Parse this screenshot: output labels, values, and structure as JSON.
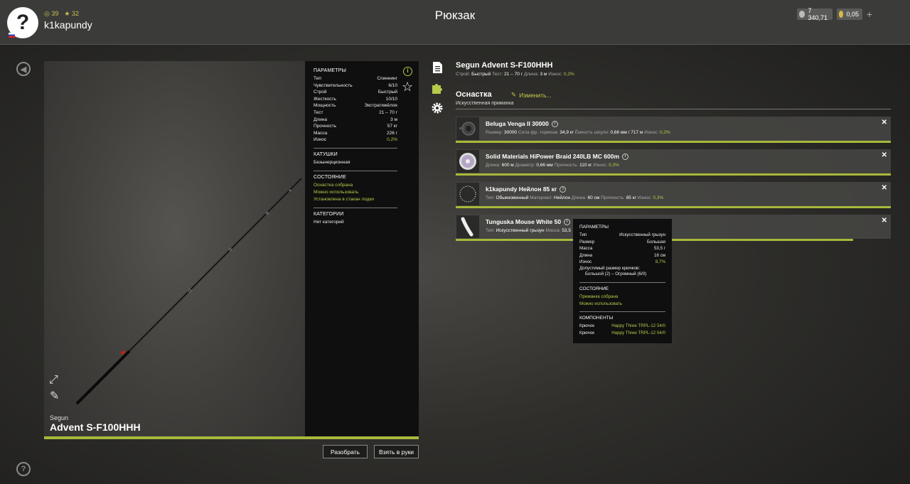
{
  "header": {
    "title": "Рюкзак",
    "username": "k1kapundy",
    "avatar_glyph": "?",
    "stat_level": "39",
    "stat_rank": "32",
    "silver": "7 340,71",
    "gold": "0,05",
    "plus": "+"
  },
  "rod": {
    "brand": "Segun",
    "name": "Advent S-F100HHH",
    "params_title": "ПАРАМЕТРЫ",
    "params": [
      {
        "k": "Тип",
        "v": "Спиннинг"
      },
      {
        "k": "Чувствительность",
        "v": "6/10"
      },
      {
        "k": "Строй",
        "v": "Быстрый"
      },
      {
        "k": "Жесткость",
        "v": "10/10"
      },
      {
        "k": "Мощность",
        "v": "Экстратяжёлое"
      },
      {
        "k": "Тест",
        "v": "21 – 70 г"
      },
      {
        "k": "Длина",
        "v": "3 м"
      },
      {
        "k": "Прочность",
        "v": "57 кг"
      },
      {
        "k": "Масса",
        "v": "226 г"
      },
      {
        "k": "Износ",
        "v": "0,2%"
      }
    ],
    "reels_title": "КАТУШКИ",
    "reels_value": "Безынерционная",
    "state_title": "СОСТОЯНИЕ",
    "state": [
      "Оснастка собрана",
      "Можно использовать",
      "Установлена в стакан лодки"
    ],
    "cat_title": "КАТЕГОРИИ",
    "cat_value": "Нет категорий"
  },
  "buttons": {
    "disassemble": "Разобрать",
    "take": "Взять в руки"
  },
  "detail": {
    "title": "Segun Advent S-F100HHH",
    "sub": {
      "build_k": "Строй:",
      "build_v": "Быстрый",
      "test_k": "Тест:",
      "test_v": "21 – 70 г",
      "len_k": "Длина:",
      "len_v": "3 м",
      "wear_k": "Износ:",
      "wear_v": "0,2%"
    },
    "osn_title": "Оснастка",
    "change": "Изменить...",
    "osn_sub": "Искусственная приманка"
  },
  "components": [
    {
      "name": "Beluga Venga II 30000",
      "desc": [
        {
          "k": "Размер:",
          "v": "30000"
        },
        {
          "k": "Сила фр. тормоза:",
          "v": "34,9 кг"
        },
        {
          "k": "Ёмкость шпули:",
          "v": "0,66 мм / 717 м"
        },
        {
          "k": "Износ:",
          "v": "0,2%",
          "g": true
        }
      ],
      "bar": 1.0
    },
    {
      "name": "Solid Materials HiPower Braid 240LB MC 600m",
      "desc": [
        {
          "k": "Длина:",
          "v": "600 м"
        },
        {
          "k": "Диаметр:",
          "v": "0,66 мм"
        },
        {
          "k": "Прочность:",
          "v": "110 кг"
        },
        {
          "k": "Износ:",
          "v": "0,3%",
          "g": true
        }
      ],
      "bar": 1.0
    },
    {
      "name": "k1kapundy Нейлон 85 кг",
      "desc": [
        {
          "k": "Тип:",
          "v": "Обыкновенный"
        },
        {
          "k": "Материал:",
          "v": "Нейлон"
        },
        {
          "k": "Длина:",
          "v": "60 см"
        },
        {
          "k": "Прочность:",
          "v": "85 кг"
        },
        {
          "k": "Износ:",
          "v": "0,3%",
          "g": true
        }
      ],
      "bar": 1.0
    },
    {
      "name": "Tunguska Mouse White 50",
      "desc": [
        {
          "k": "Тип:",
          "v": "Искусственный грызун"
        },
        {
          "k": "Масса:",
          "v": "53,5"
        }
      ],
      "bar": 0.913
    }
  ],
  "tooltip": {
    "params_title": "ПАРАМЕТРЫ",
    "params": [
      {
        "k": "Тип",
        "v": "Искусственный грызун"
      },
      {
        "k": "Размер",
        "v": "Большая"
      },
      {
        "k": "Масса",
        "v": "53,5 г"
      },
      {
        "k": "Длина",
        "v": "16 см"
      },
      {
        "k": "Износ",
        "v": "8,7%"
      }
    ],
    "hook_label": "Допустимый размер крючков:",
    "hook_value": "Большой (2) – Огромный (6/0)",
    "state_title": "СОСТОЯНИЕ",
    "state": [
      "Приманка собрана",
      "Можно использовать"
    ],
    "comp_title": "КОМПОНЕНТЫ",
    "comps": [
      {
        "k": "Крючок",
        "v": "Happy Three TRPL-12 54/0"
      },
      {
        "k": "Крючок",
        "v": "Happy Three TRPL-12 54/0"
      }
    ]
  },
  "colors": {
    "accent": "#b8c84a",
    "bar": "#a8b83a",
    "panel": "#0f0f0f"
  }
}
